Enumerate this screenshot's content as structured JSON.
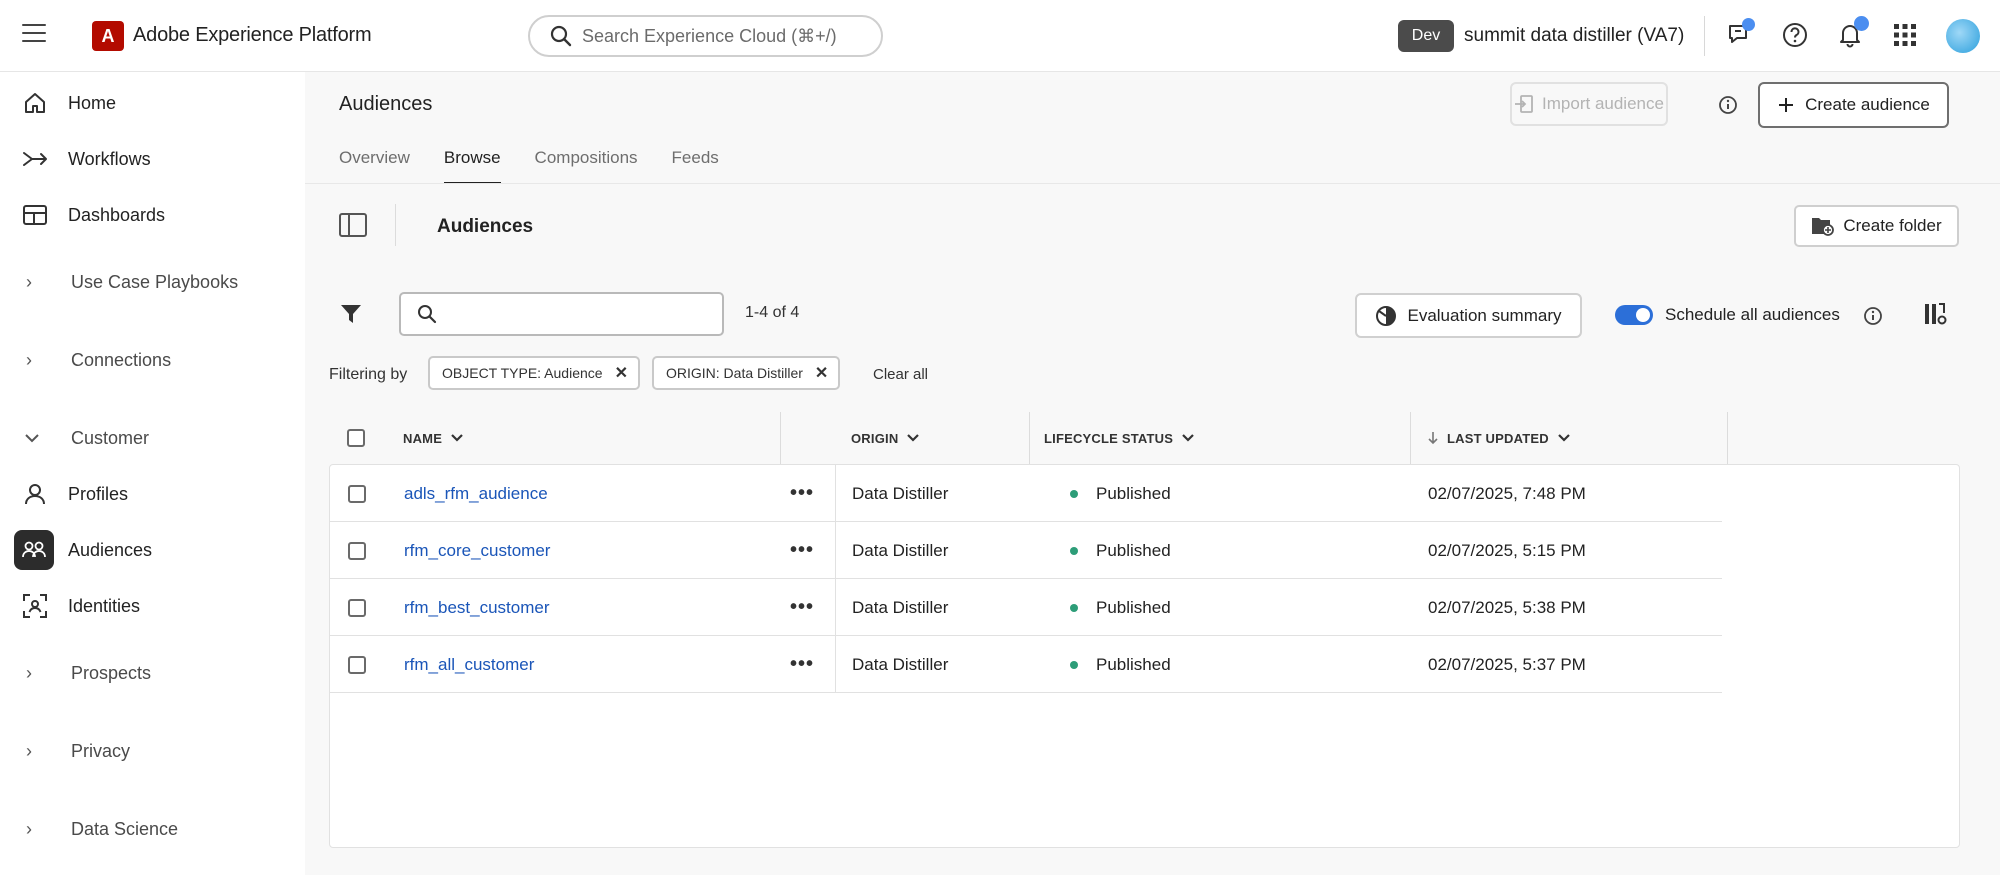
{
  "header": {
    "app_title": "Adobe Experience Platform",
    "logo_letter": "A",
    "search_placeholder": "Search Experience Cloud (⌘+/)",
    "env_badge": "Dev",
    "org_name": "summit data distiller (VA7)"
  },
  "sidebar": {
    "items": [
      {
        "label": "Home",
        "icon": "home-icon"
      },
      {
        "label": "Workflows",
        "icon": "workflows-icon"
      },
      {
        "label": "Dashboards",
        "icon": "dashboards-icon"
      },
      {
        "label": "Use Case Playbooks",
        "group": true
      },
      {
        "label": "Connections",
        "group": true
      },
      {
        "label": "Customer",
        "group": true,
        "expanded": true
      },
      {
        "label": "Profiles",
        "icon": "profiles-icon"
      },
      {
        "label": "Audiences",
        "icon": "audiences-icon",
        "active": true
      },
      {
        "label": "Identities",
        "icon": "identities-icon"
      },
      {
        "label": "Prospects",
        "group": true
      },
      {
        "label": "Privacy",
        "group": true
      },
      {
        "label": "Data Science",
        "group": true
      }
    ]
  },
  "page": {
    "title": "Audiences",
    "import_label": "Import audience",
    "create_label": "Create audience",
    "tabs": [
      "Overview",
      "Browse",
      "Compositions",
      "Feeds"
    ],
    "active_tab": "Browse"
  },
  "browse": {
    "title": "Audiences",
    "create_folder_label": "Create folder",
    "search_value": "",
    "count": "1-4 of 4",
    "eval_label": "Evaluation summary",
    "schedule_label": "Schedule all audiences",
    "schedule_on": true,
    "filtering_by": "Filtering by",
    "chips": [
      "OBJECT TYPE: Audience",
      "ORIGIN: Data Distiller"
    ],
    "clear_all": "Clear all"
  },
  "table": {
    "columns": [
      "NAME",
      "ORIGIN",
      "LIFECYCLE STATUS",
      "LAST UPDATED"
    ],
    "rows": [
      {
        "name": "adls_rfm_audience",
        "origin": "Data Distiller",
        "status": "Published",
        "updated": "02/07/2025, 7:48 PM"
      },
      {
        "name": "rfm_core_customer",
        "origin": "Data Distiller",
        "status": "Published",
        "updated": "02/07/2025, 5:15 PM"
      },
      {
        "name": "rfm_best_customer",
        "origin": "Data Distiller",
        "status": "Published",
        "updated": "02/07/2025, 5:38 PM"
      },
      {
        "name": "rfm_all_customer",
        "origin": "Data Distiller",
        "status": "Published",
        "updated": "02/07/2025, 5:37 PM"
      }
    ]
  },
  "colors": {
    "brand": "#b30b00",
    "link": "#1a55b8",
    "toggle": "#2c6fd8",
    "published": "#2d9d78"
  }
}
